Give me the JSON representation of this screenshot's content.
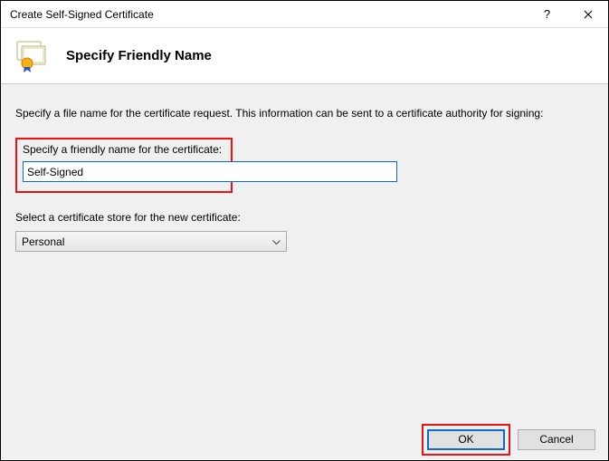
{
  "window": {
    "title": "Create Self-Signed Certificate"
  },
  "header": {
    "title": "Specify Friendly Name"
  },
  "content": {
    "description": "Specify a file name for the certificate request.  This information can be sent to a certificate authority for signing:",
    "friendly_name_label": "Specify a friendly name for the certificate:",
    "friendly_name_value": "Self-Signed",
    "store_label": "Select a certificate store for the new certificate:",
    "store_value": "Personal"
  },
  "footer": {
    "ok_label": "OK",
    "cancel_label": "Cancel"
  }
}
